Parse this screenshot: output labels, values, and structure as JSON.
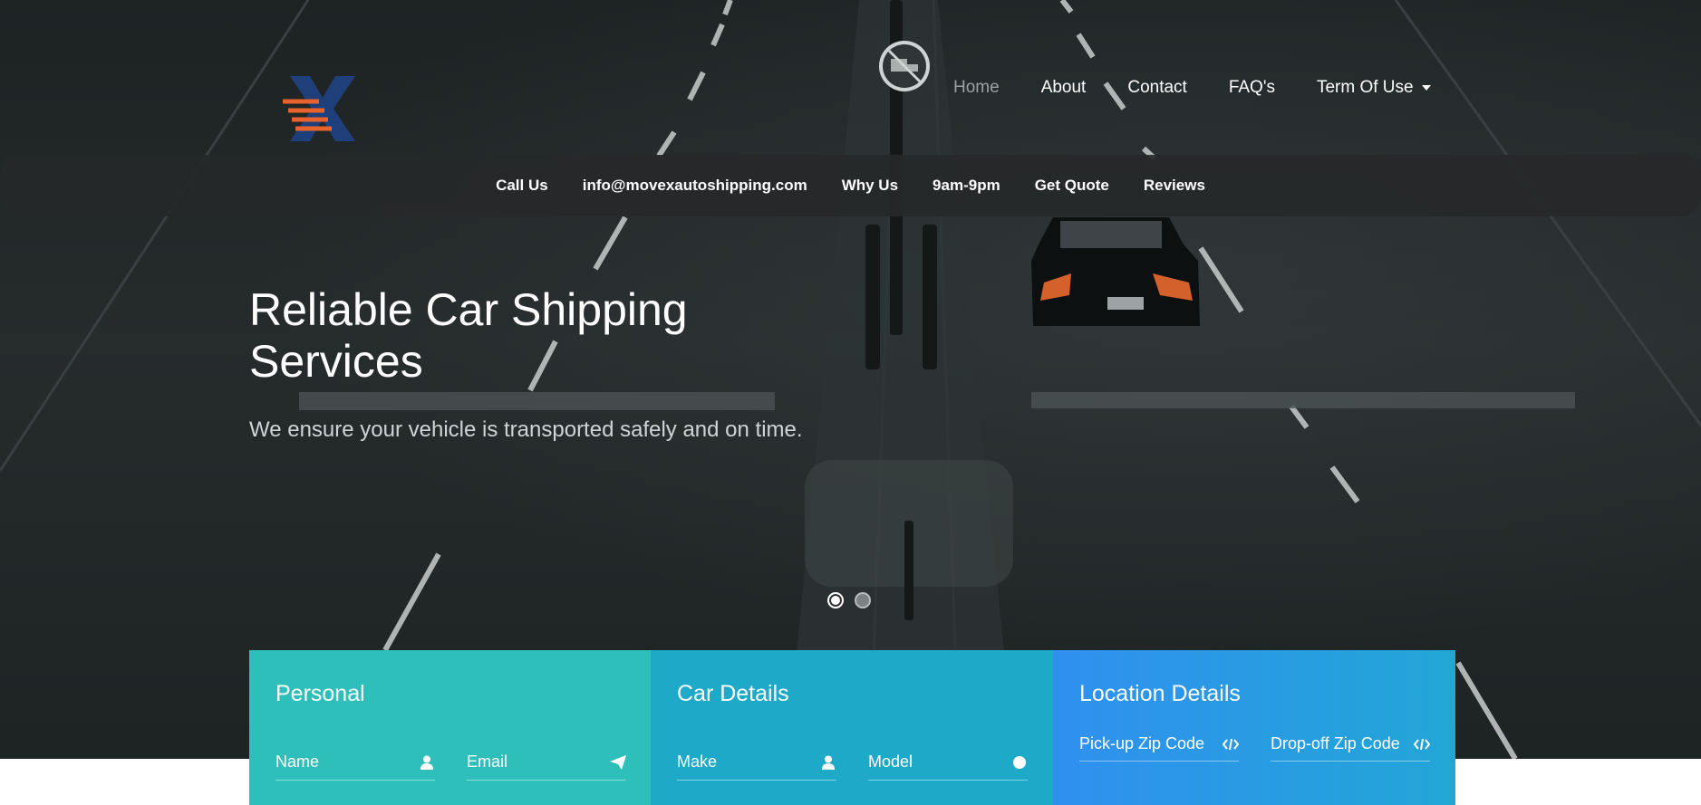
{
  "header": {
    "nav": [
      {
        "label": "Home",
        "active": true
      },
      {
        "label": "About"
      },
      {
        "label": "Contact"
      },
      {
        "label": "FAQ's"
      },
      {
        "label": "Term Of Use",
        "has_dropdown": true
      }
    ]
  },
  "subnav": {
    "items": [
      "Call Us",
      "info@movexautoshipping.com",
      "Why Us",
      "9am-9pm",
      "Get Quote",
      "Reviews"
    ]
  },
  "hero": {
    "title": "Reliable Car Shipping Services",
    "subtitle": "We ensure your vehicle is transported safely and on time.",
    "slides": 2,
    "active_slide": 1
  },
  "form": {
    "personal": {
      "title": "Personal",
      "name_label": "Name",
      "email_label": "Email"
    },
    "car": {
      "title": "Car Details",
      "make_label": "Make",
      "model_label": "Model"
    },
    "location": {
      "title": "Location Details",
      "pickup_label": "Pick-up Zip Code",
      "dropoff_label": "Drop-off Zip Code"
    }
  },
  "colors": {
    "personal_bg": "#2ebfbb",
    "car_bg": "#1ea9c8",
    "location_bg_start": "#3090f0",
    "location_bg_end": "#22a6d6",
    "logo_accent": "#e8622c",
    "logo_base": "#1f3f7a"
  },
  "icons": {
    "name": "user-icon",
    "email": "paper-plane-icon",
    "make": "user-icon",
    "model": "circle-icon",
    "pickup": "code-icon",
    "dropoff": "code-icon"
  }
}
